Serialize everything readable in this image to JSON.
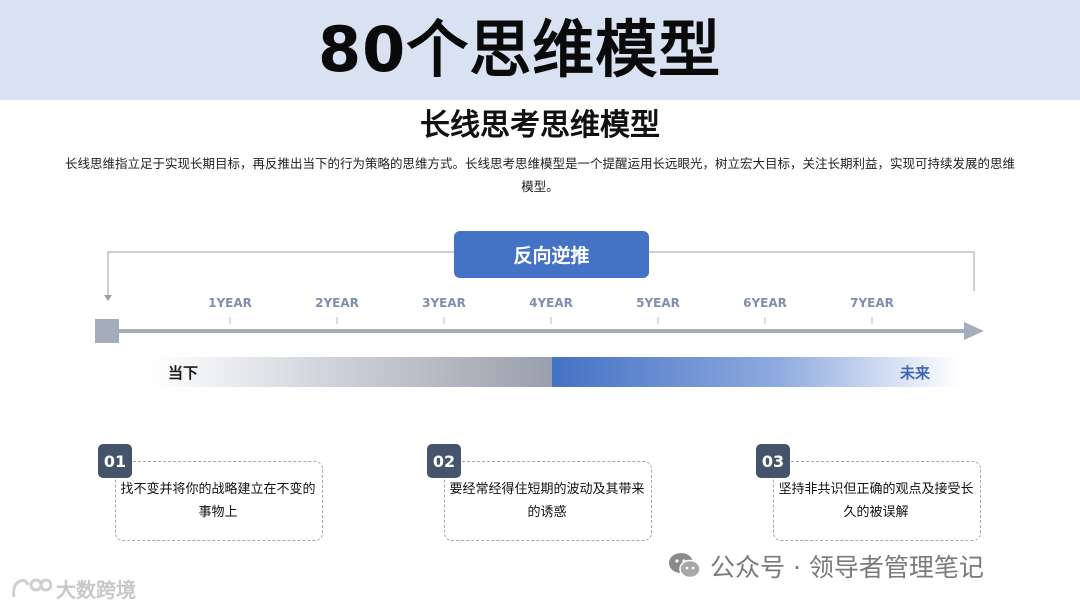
{
  "header": {
    "title": "80个思维模型"
  },
  "model": {
    "title": "长线思考思维模型",
    "description": "长线思维指立足于实现长期目标，再反推出当下的行为策略的思维方式。长线思考思维模型是一个提醒运用长远眼光，树立宏大目标，关注长期利益，实现可持续发展的思维模型。"
  },
  "timeline": {
    "reverse_label": "反向逆推",
    "years": [
      "1YEAR",
      "2YEAR",
      "3YEAR",
      "4YEAR",
      "5YEAR",
      "6YEAR",
      "7YEAR"
    ],
    "now_label": "当下",
    "future_label": "未来"
  },
  "cards": [
    {
      "num": "01",
      "text": "找不变并将你的战略建立在不变的事物上"
    },
    {
      "num": "02",
      "text": "要经常经得住短期的波动及其带来的诱惑"
    },
    {
      "num": "03",
      "text": "坚持非共识但正确的观点及接受长久的被误解"
    }
  ],
  "watermarks": {
    "account": "公众号 · 领导者管理笔记",
    "brand": "大数跨境"
  },
  "colors": {
    "banner": "#d9e2f3",
    "accent": "#4472c4",
    "badge": "#44546a",
    "axis": "#a5adbb"
  }
}
